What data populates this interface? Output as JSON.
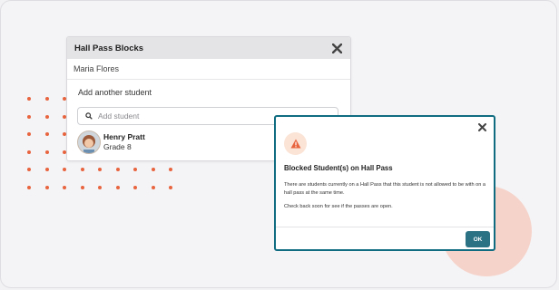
{
  "colors": {
    "accent_teal": "#0f6c81",
    "ok_button": "#2b7285",
    "dot_orange": "#e8643e",
    "circle_pink": "#f6d3ca",
    "warning_icon": "#e8643e"
  },
  "hall_pass_dialog": {
    "title": "Hall Pass Blocks",
    "close_icon": "close-icon",
    "selected_student": "Maria Flores",
    "add_label": "Add another student",
    "search_placeholder": "Add student",
    "search_icon": "search-icon",
    "students": [
      {
        "name": "Henry Pratt",
        "grade": "Grade 8"
      }
    ]
  },
  "blocked_dialog": {
    "close_icon": "close-icon",
    "warning_icon": "warning-icon",
    "title": "Blocked Student(s) on Hall Pass",
    "message_1": "There are students currently on a Hall Pass that this student is not allowed to be with on a hall pass at the same time.",
    "message_2": "Check back soon for see if the passes are open.",
    "ok_label": "OK"
  }
}
